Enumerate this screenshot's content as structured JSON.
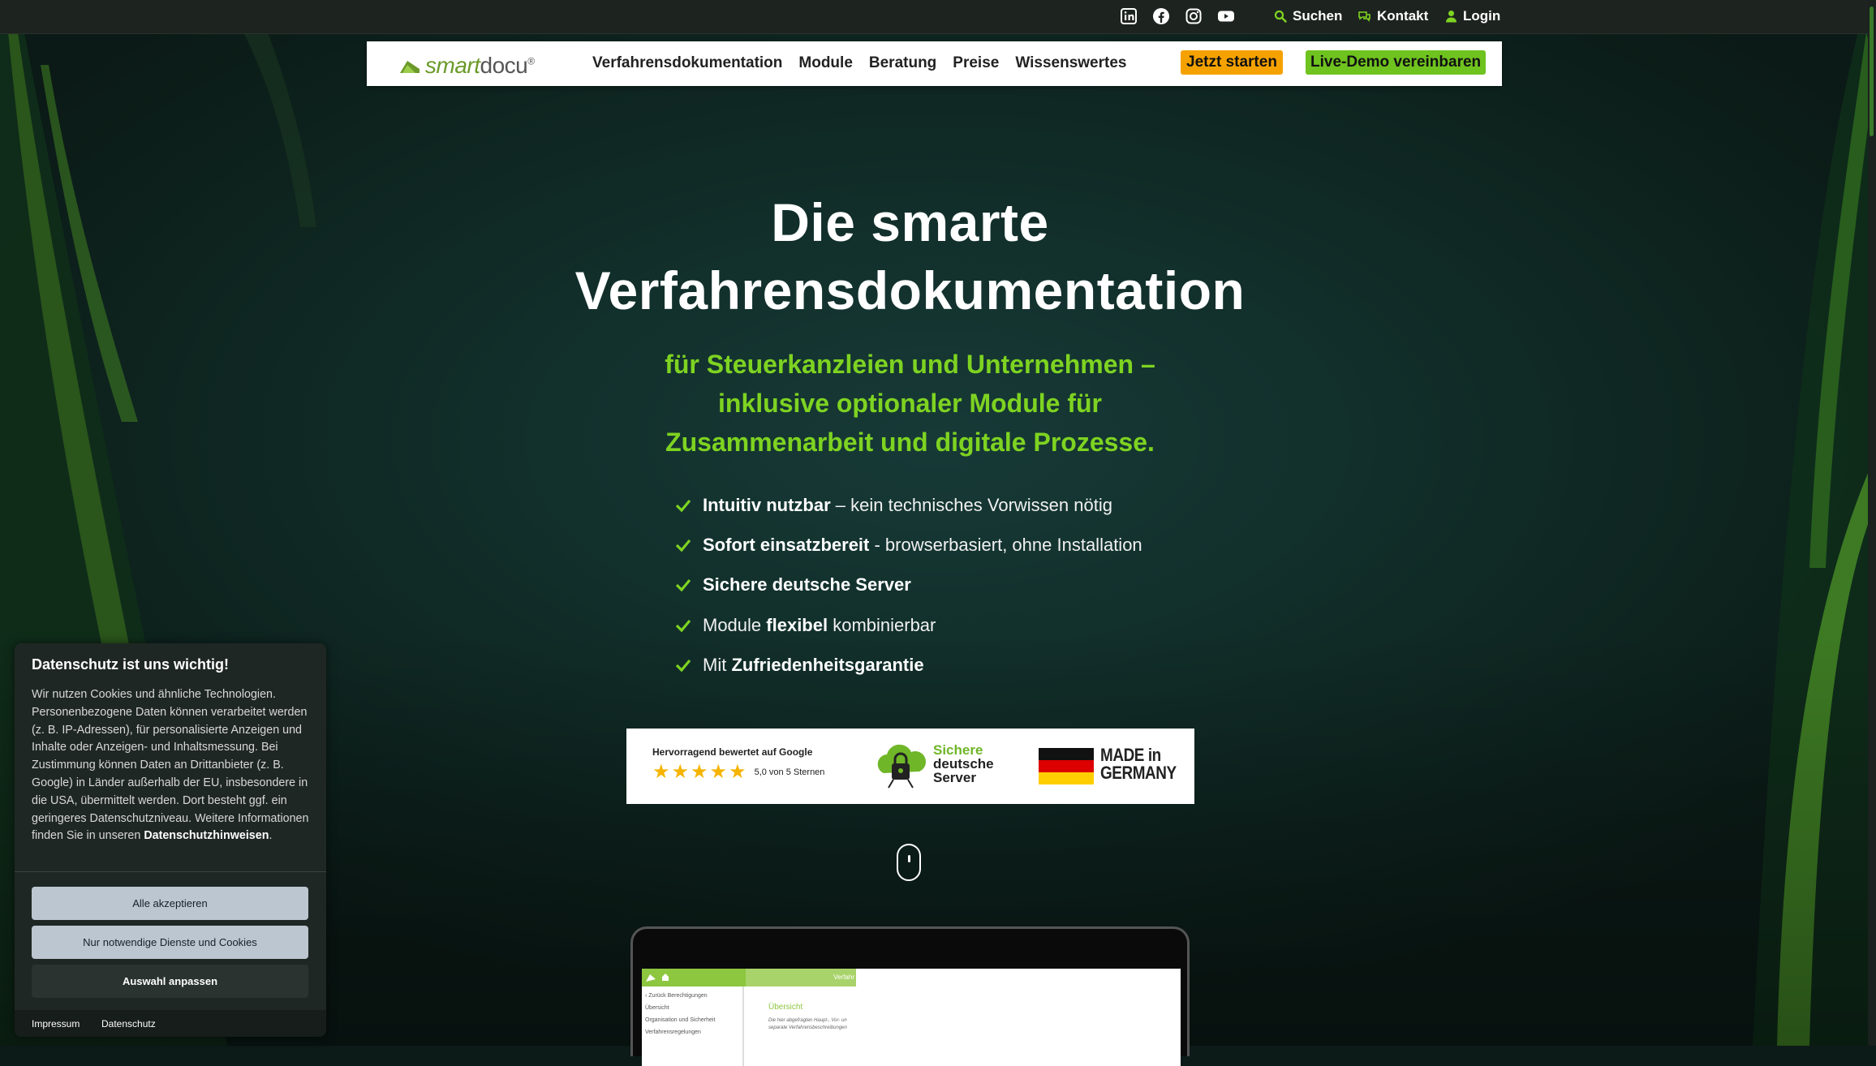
{
  "topbar": {
    "social": [
      "linkedin-icon",
      "facebook-icon",
      "instagram-icon",
      "youtube-icon"
    ],
    "search_label": "Suchen",
    "contact_label": "Kontakt",
    "login_label": "Login"
  },
  "nav": {
    "logo_smart": "smart",
    "logo_docu": "docu",
    "logo_reg": "®",
    "items": [
      "Verfahrensdokumentation",
      "Module",
      "Beratung",
      "Preise",
      "Wissenswertes"
    ],
    "cta_start": "Jetzt starten",
    "cta_demo": "Live-Demo vereinbaren"
  },
  "hero": {
    "title_line1": "Die smarte",
    "title_line2": "Verfahrensdokumentation",
    "subtitle_line1": "für Steuerkanzleien und Unternehmen –",
    "subtitle_line2": "inklusive optionaler Module für",
    "subtitle_line3": "Zusammenarbeit und digitale Prozesse.",
    "features": [
      {
        "pre": "",
        "bold": "Intuitiv nutzbar",
        "post": " – kein technisches Vorwissen nötig"
      },
      {
        "pre": "",
        "bold": "Sofort einsatzbereit",
        "post": " - browserbasiert, ohne Installation"
      },
      {
        "pre": "",
        "bold": "Sichere deutsche Server",
        "post": ""
      },
      {
        "pre": "Module ",
        "bold": "flexibel",
        "post": " kombinierbar"
      },
      {
        "pre": "Mit ",
        "bold": "Zufriedenheitsgarantie",
        "post": ""
      }
    ]
  },
  "badges": {
    "google_title": "Hervorragend bewertet auf Google",
    "stars": 5,
    "rating_text": "5,0 von 5 Sternen",
    "server_line1": "Sichere",
    "server_line2": "deutsche",
    "server_line3": "Server",
    "made_line1": "MADE in",
    "made_line2": "GERMANY"
  },
  "app_preview": {
    "header_text": "Verfahr",
    "sidebar": [
      "‹ Zurück   Berechtigungen",
      "Übersicht",
      "Organisation und Sicherheit",
      "Verfahrensregelungen"
    ],
    "overview_title": "Übersicht",
    "overview_text_1": "Die hier abgefragten Haupt-, Vor- un",
    "overview_text_2": "separate Verfahrensbeschreibungen"
  },
  "cookie": {
    "title": "Datenschutz ist uns wichtig!",
    "text": "Wir nutzen Cookies und ähnliche Technologien. Personenbezogene Daten können verarbeitet werden (z. B. IP-Adressen), für personalisierte Anzeigen und Inhalte oder Anzeigen- und Inhaltsmessung. Bei Zustimmung können Daten an Drittanbieter (z. B. Google) in Länder außerhalb der EU, insbesondere in die USA, übermittelt werden. Dort besteht ggf. ein geringeres Datenschutzniveau. Weitere Informationen finden Sie in unseren ",
    "link": "Datenschutzhinweisen",
    "text_end": ".",
    "accept_all": "Alle akzeptieren",
    "necessary_only": "Nur notwendige Dienste und Cookies",
    "customize": "Auswahl anpassen",
    "footer_impressum": "Impressum",
    "footer_datenschutz": "Datenschutz"
  },
  "colors": {
    "accent_green": "#7ed321",
    "cta_orange": "#f5a200",
    "cta_green": "#6fc31f",
    "topbar": "#1d2420"
  }
}
